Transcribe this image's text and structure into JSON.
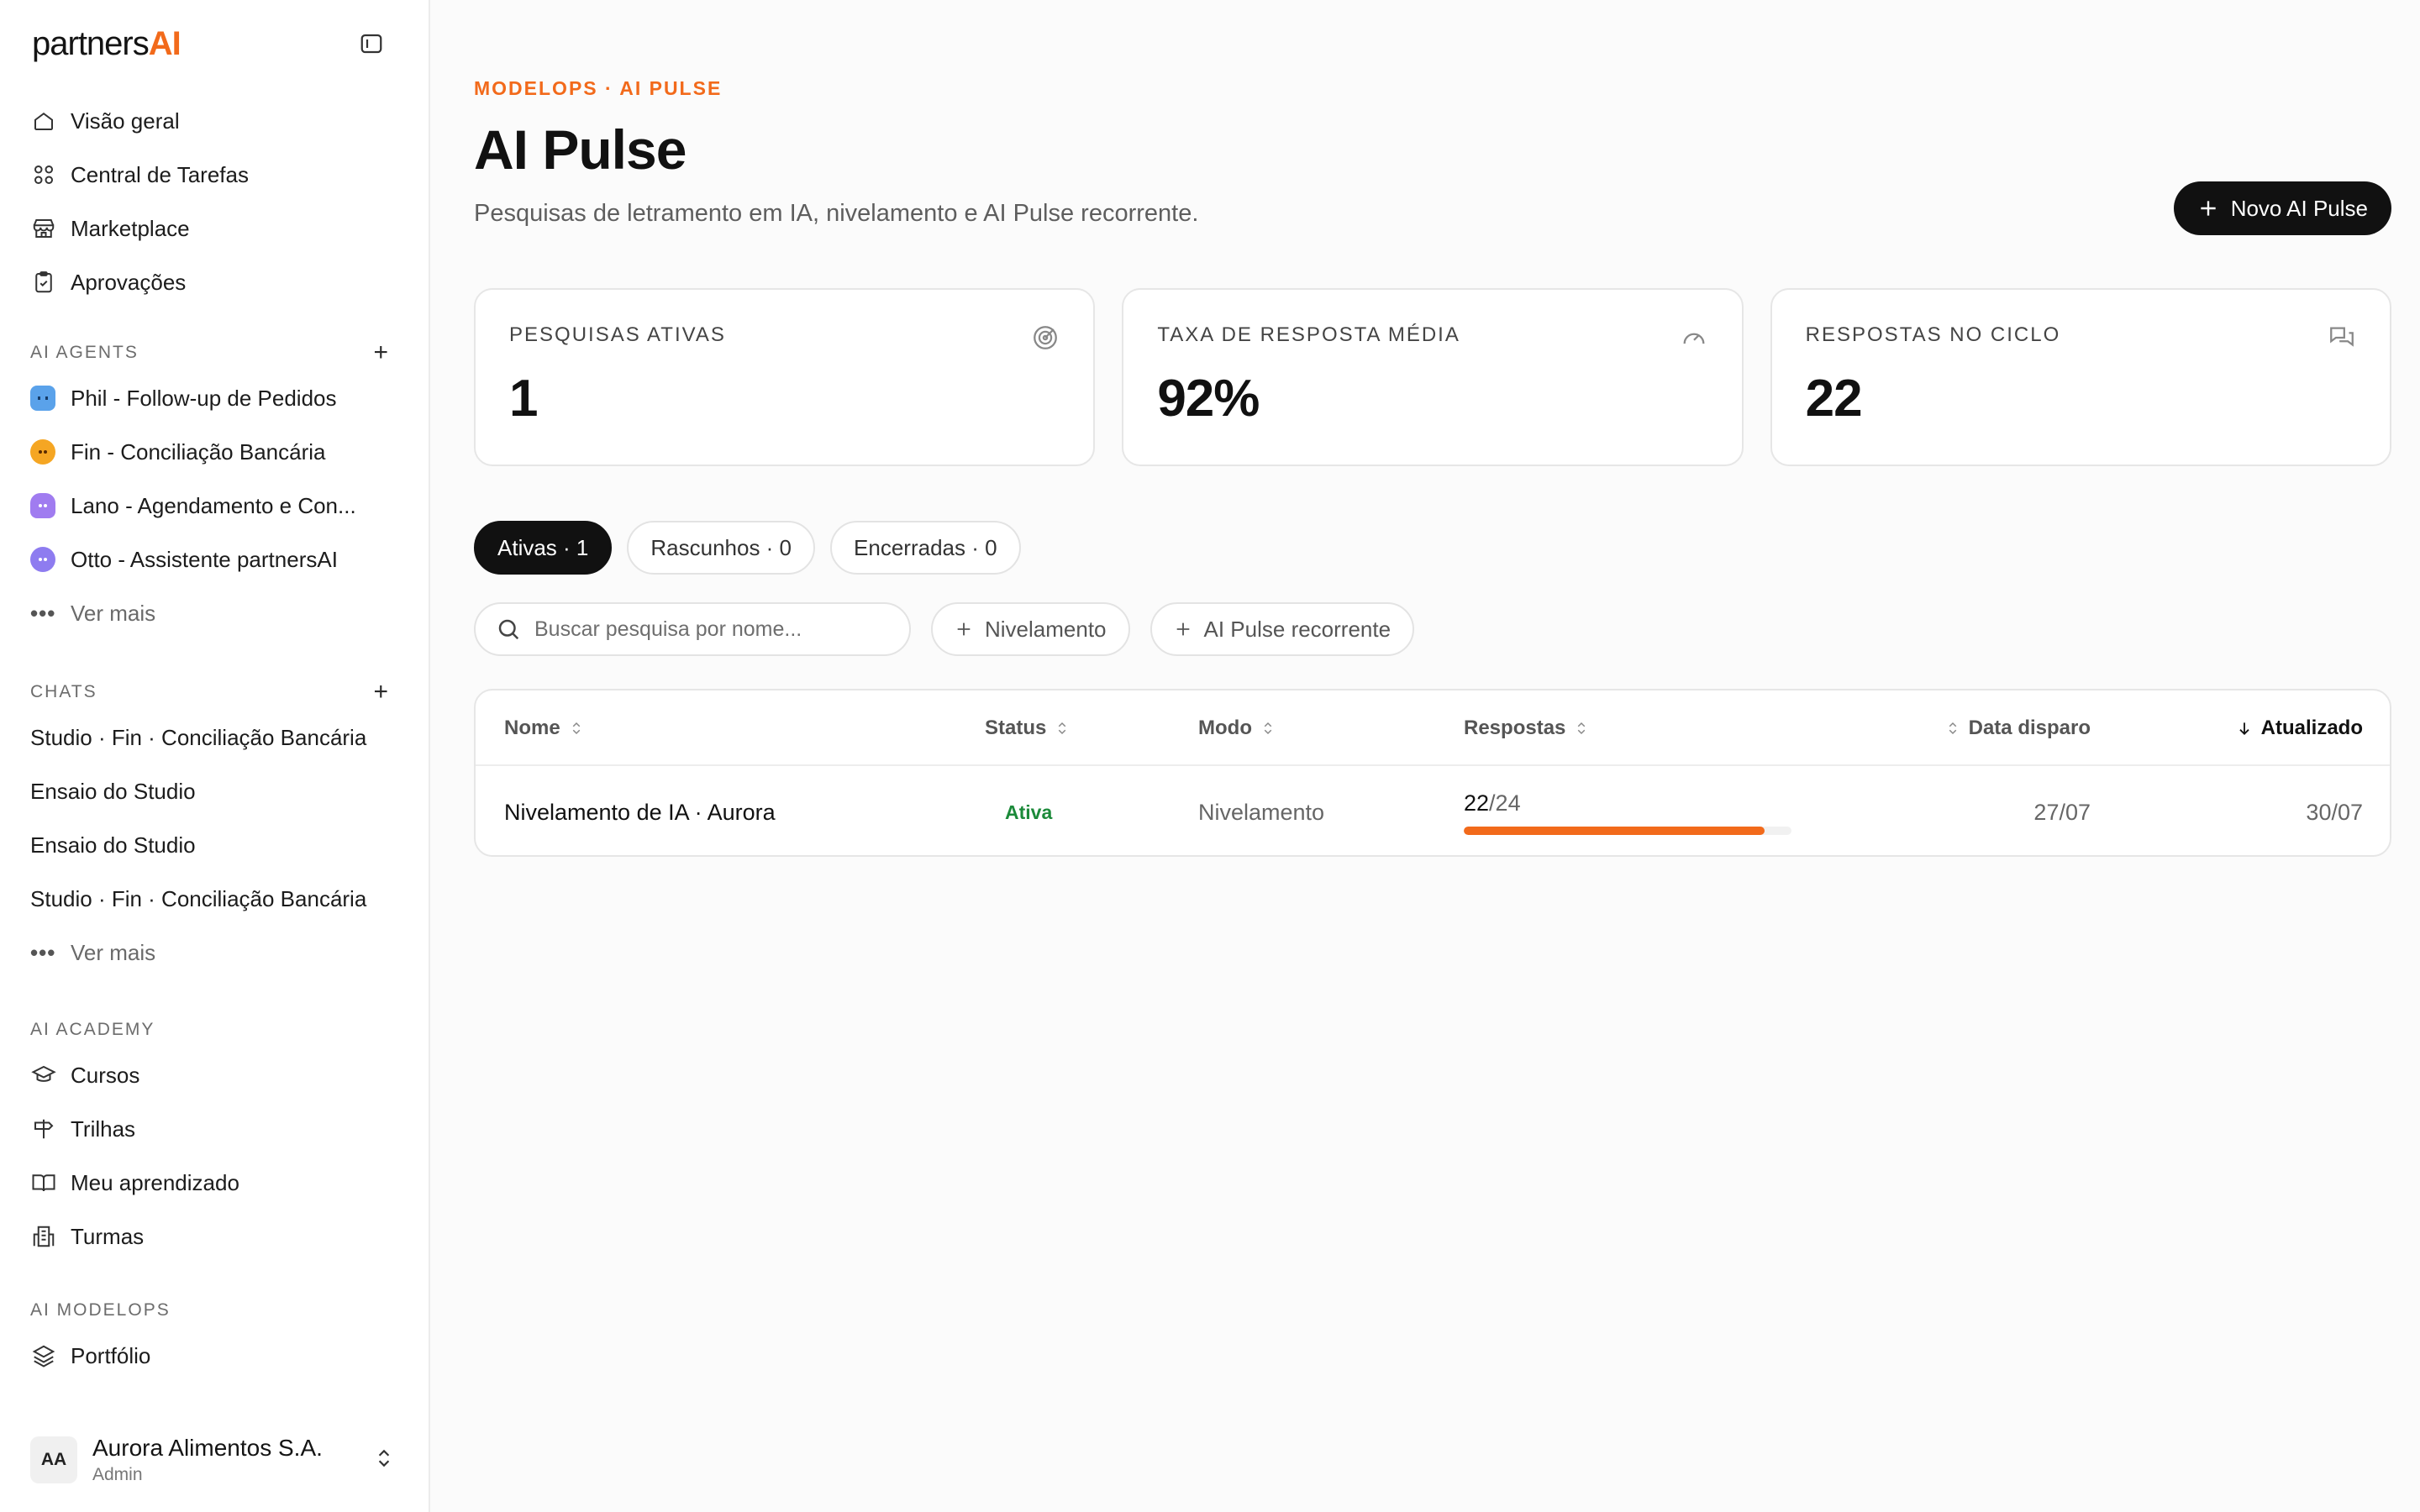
{
  "brand": {
    "name_prefix": "partners",
    "name_suffix": "AI",
    "accent": "#f26a1b"
  },
  "sidebar": {
    "main_nav": [
      {
        "label": "Visão geral",
        "icon": "home-icon"
      },
      {
        "label": "Central de Tarefas",
        "icon": "grid-icon"
      },
      {
        "label": "Marketplace",
        "icon": "store-icon"
      },
      {
        "label": "Aprovações",
        "icon": "clipboard-check-icon"
      }
    ],
    "agents_title": "AI AGENTS",
    "agents": [
      {
        "label": "Phil - Follow-up de Pedidos",
        "avatar_color": "#4a90e2"
      },
      {
        "label": "Fin - Conciliação Bancária",
        "avatar_color": "#f5a623"
      },
      {
        "label": "Lano - Agendamento e Con...",
        "avatar_color": "#9b6cf0"
      },
      {
        "label": "Otto - Assistente partnersAI",
        "avatar_color": "#8e7cf0"
      }
    ],
    "agents_more": "Ver mais",
    "chats_title": "CHATS",
    "chats": [
      {
        "label": "Studio · Fin · Conciliação Bancária"
      },
      {
        "label": "Ensaio do Studio"
      },
      {
        "label": "Ensaio do Studio"
      },
      {
        "label": "Studio · Fin · Conciliação Bancária"
      }
    ],
    "chats_more": "Ver mais",
    "academy_title": "AI ACADEMY",
    "academy": [
      {
        "label": "Cursos",
        "icon": "graduation-cap-icon"
      },
      {
        "label": "Trilhas",
        "icon": "signpost-icon"
      },
      {
        "label": "Meu aprendizado",
        "icon": "book-open-icon"
      },
      {
        "label": "Turmas",
        "icon": "building-icon"
      }
    ],
    "modelops_title": "AI MODELOPS",
    "modelops": [
      {
        "label": "Portfólio",
        "icon": "layers-icon"
      }
    ],
    "account": {
      "initials": "AA",
      "name": "Aurora Alimentos S.A.",
      "role": "Admin"
    }
  },
  "header": {
    "eyebrow": "MODELOPS · AI PULSE",
    "title": "AI Pulse",
    "subtitle": "Pesquisas de letramento em IA, nivelamento e AI Pulse recorrente.",
    "primary_button": "Novo AI Pulse"
  },
  "stats": [
    {
      "label": "PESQUISAS ATIVAS",
      "value": "1",
      "icon": "target-icon"
    },
    {
      "label": "TAXA DE RESPOSTA MÉDIA",
      "value": "92%",
      "icon": "gauge-icon"
    },
    {
      "label": "RESPOSTAS NO CICLO",
      "value": "22",
      "icon": "messages-icon"
    }
  ],
  "tabs": [
    {
      "label": "Ativas · 1",
      "active": true
    },
    {
      "label": "Rascunhos · 0",
      "active": false
    },
    {
      "label": "Encerradas · 0",
      "active": false
    }
  ],
  "filters": {
    "search_placeholder": "Buscar pesquisa por nome...",
    "chip_leveling": "Nivelamento",
    "chip_recurring": "AI Pulse recorrente"
  },
  "table": {
    "columns": {
      "name": "Nome",
      "status": "Status",
      "mode": "Modo",
      "responses": "Respostas",
      "dispatch_date": "Data disparo",
      "updated": "Atualizado"
    },
    "rows": [
      {
        "name": "Nivelamento de IA · Aurora",
        "status": "Ativa",
        "mode": "Nivelamento",
        "responses_done": "22",
        "responses_total": "/24",
        "responses_fraction": 0.9167,
        "dispatch_date": "27/07",
        "updated": "30/07"
      }
    ]
  }
}
